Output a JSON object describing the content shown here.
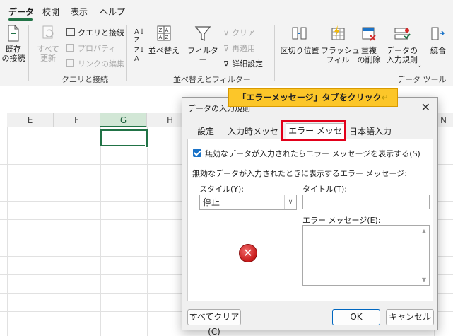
{
  "ribbon_tabs": [
    "データ",
    "校閲",
    "表示",
    "ヘルプ"
  ],
  "ribbon": {
    "get_data": {
      "existing_connections": "既存\nの接続",
      "refresh_all": "すべて\n更新"
    },
    "queries": {
      "queries_connections": "クエリと接続",
      "properties": "プロパティ",
      "edit_links": "リンクの編集",
      "group_label": "クエリと接続"
    },
    "sort_filter": {
      "sort": "並べ替え",
      "filter": "フィルター",
      "clear": "クリア",
      "reapply": "再適用",
      "advanced": "詳細設定",
      "group_label": "並べ替えとフィルター"
    },
    "data_tools": {
      "text_to_columns": "区切り位置",
      "flash_fill": "フラッシュ\nフィル",
      "remove_duplicates": "重複\nの削除",
      "data_validation": "データの\n入力規則",
      "consolidate": "統合",
      "group_label": "データ ツール"
    }
  },
  "sheet": {
    "columns": [
      "E",
      "F",
      "G",
      "H",
      "N"
    ],
    "selected_column": "G"
  },
  "callout": "「エラーメッセージ」タブをクリック",
  "dialog": {
    "title": "データの入力規則",
    "tabs": [
      "設定",
      "入力時メッセージ",
      "エラー メッセージ",
      "日本語入力"
    ],
    "active_tab": "エラー メッセージ",
    "show_error_checkbox": "無効なデータが入力されたらエラー メッセージを表示する(S)",
    "group_heading": "無効なデータが入力されたときに表示するエラー メッセージ:",
    "style_label": "スタイル(Y):",
    "style_value": "停止",
    "title_label": "タイトル(T):",
    "title_value": "",
    "error_message_label": "エラー メッセージ(E):",
    "error_message_value": "",
    "clear_all_button": "すべてクリア(C)",
    "ok_button": "OK",
    "cancel_button": "キャンセル"
  },
  "colors": {
    "accent": "#217346",
    "highlight_red": "#e2001a",
    "callout_yellow": "#fcc629",
    "checkbox_blue": "#1a73c8"
  }
}
